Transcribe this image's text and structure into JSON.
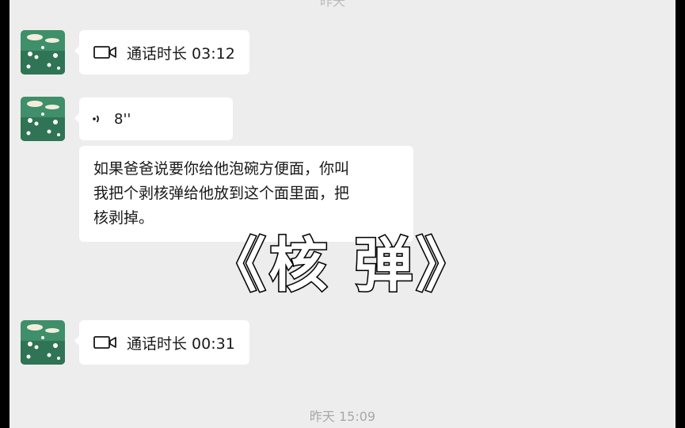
{
  "top_partial_text": "昨天",
  "messages": [
    {
      "type": "call",
      "icon": "video-camera-icon",
      "label": "通话时长 03:12"
    },
    {
      "type": "voice",
      "icon": "voice-wave-icon",
      "duration": "8''"
    },
    {
      "type": "text",
      "lines": [
        "如果爸爸说要你给他泡碗方便面，你叫",
        "我把个剥核弹给他放到这个面里面，把",
        "核剥掉。"
      ]
    },
    {
      "type": "call",
      "icon": "video-camera-icon",
      "label": "通话时长 00:31"
    }
  ],
  "overlay_title": "《核 弹》",
  "timestamp": "昨天 15:09",
  "colors": {
    "background": "#ededed",
    "bubble": "#ffffff",
    "text": "#191919",
    "timestamp": "#a8a8a8"
  }
}
